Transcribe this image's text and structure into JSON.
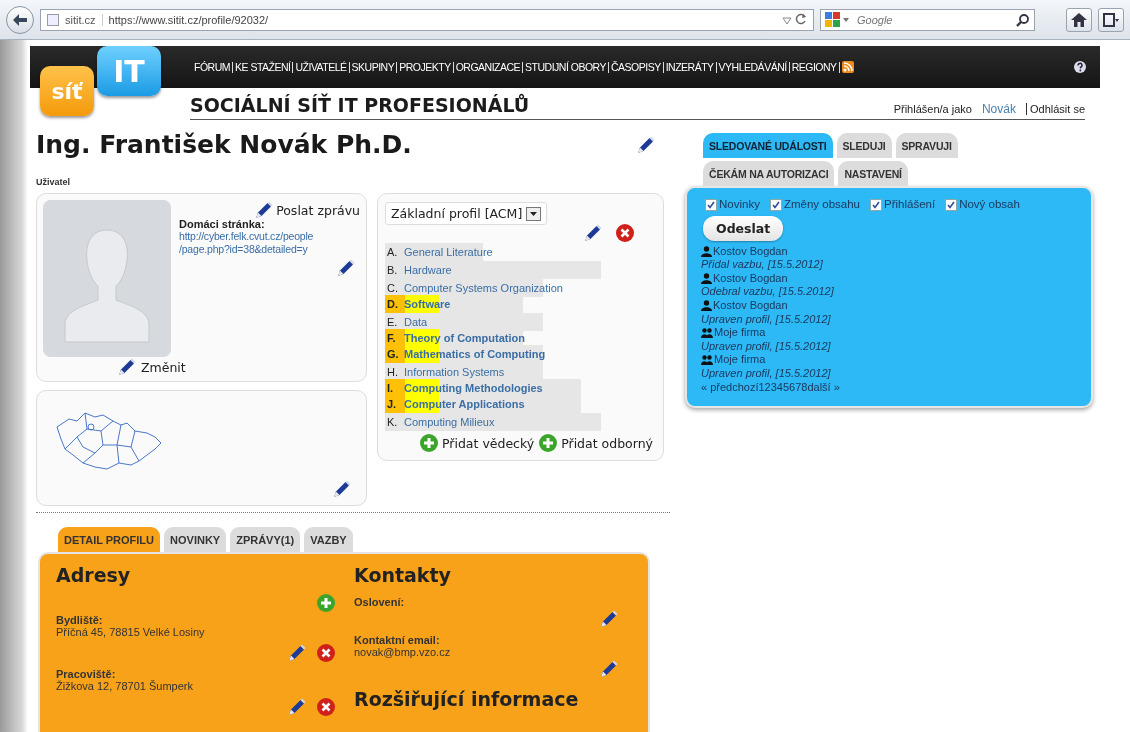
{
  "browser": {
    "site_identity": "sitit.cz",
    "url": "https://www.sitit.cz/profile/92032/",
    "search_placeholder": "Google"
  },
  "header": {
    "logo_left": "síť",
    "logo_right": "IT",
    "nav": [
      "FÓRUM",
      "KE STAŽENÍ",
      "UŽIVATELÉ",
      "SKUPINY",
      "PROJEKTY",
      "ORGANIZACE",
      "STUDIJNÍ OBORY",
      "ČASOPISY",
      "INZERÁTY",
      "VYHLEDÁVÁNÍ",
      "REGIONY"
    ],
    "site_title": "SOCIÁLNÍ SÍŤ IT PROFESIONÁLŮ",
    "login_label": "Přihlášen/a jako",
    "user_link": "Novák",
    "logout_link": "Odhlásit se"
  },
  "profile": {
    "name": "Ing. František Novák Ph.D.",
    "role": "Uživatel",
    "send_message": "Poslat zprávu",
    "homepage_label": "Domáci stránka:",
    "homepage_url_lines": [
      "http://cyber.felk.cvut.cz/people",
      "/page.php?id=38&detailed=y"
    ],
    "change_photo": "Změnit"
  },
  "acm": {
    "profile_select": "Základní profil [ACM]",
    "categories": [
      {
        "letter": "A.",
        "name": "General Literature",
        "highlighted": false
      },
      {
        "letter": "B.",
        "name": "Hardware",
        "highlighted": false
      },
      {
        "letter": "C.",
        "name": "Computer Systems Organization",
        "highlighted": false
      },
      {
        "letter": "D.",
        "name": "Software",
        "highlighted": true
      },
      {
        "letter": "E.",
        "name": "Data",
        "highlighted": false
      },
      {
        "letter": "F.",
        "name": "Theory of Computation",
        "highlighted": true
      },
      {
        "letter": "G.",
        "name": "Mathematics of Computing",
        "highlighted": true
      },
      {
        "letter": "H.",
        "name": "Information Systems",
        "highlighted": false
      },
      {
        "letter": "I.",
        "name": "Computing Methodologies",
        "highlighted": true
      },
      {
        "letter": "J.",
        "name": "Computer Applications",
        "highlighted": true
      },
      {
        "letter": "K.",
        "name": "Computing Milieux",
        "highlighted": false
      }
    ],
    "add_scientific": "Přidat vědecký",
    "add_professional": "Přidat odborný"
  },
  "events": {
    "tabs": [
      {
        "label": "SLEDOVANÉ UDÁLOSTI",
        "selected": true
      },
      {
        "label": "SLEDUJI",
        "selected": false
      },
      {
        "label": "SPRAVUJI",
        "selected": false
      },
      {
        "label": "ČEKÁM NA AUTORIZACI",
        "selected": false
      },
      {
        "label": "NASTAVENÍ",
        "selected": false
      }
    ],
    "filters": [
      {
        "label": "Novinky",
        "checked": true
      },
      {
        "label": "Změny obsahu",
        "checked": true
      },
      {
        "label": "Přihlášení",
        "checked": true
      },
      {
        "label": "Nový obsah",
        "checked": true
      }
    ],
    "submit": "Odeslat",
    "items": [
      {
        "kind": "user",
        "actor": "Kostov Bogdan",
        "action": "Přidal vazbu, [15.5.2012]"
      },
      {
        "kind": "user",
        "actor": "Kostov Bogdan",
        "action": "Odebral vazbu, [15.5.2012]"
      },
      {
        "kind": "user",
        "actor": "Kostov Bogdan",
        "action": "Upraven profil, [15.5.2012]"
      },
      {
        "kind": "group",
        "actor": "Moje firma",
        "action": "Upraven profil, [15.5.2012]"
      },
      {
        "kind": "group",
        "actor": "Moje firma",
        "action": "Upraven profil, [15.5.2012]"
      }
    ],
    "pager": "« předchozí12345678další »"
  },
  "detail": {
    "tabs": [
      {
        "label": "DETAIL PROFILU",
        "selected": true
      },
      {
        "label": "NOVINKY",
        "selected": false
      },
      {
        "label": "ZPRÁVY(1)",
        "selected": false
      },
      {
        "label": "VAZBY",
        "selected": false
      }
    ],
    "addresses_title": "Adresy",
    "addresses": [
      {
        "label": "Bydliště:",
        "value": "Příčná 45, 78815 Velké Losiny"
      },
      {
        "label": "Pracoviště:",
        "value": "Žižkova 12, 78701 Šumperk"
      }
    ],
    "contacts_title": "Kontakty",
    "contacts": [
      {
        "label": "Oslovení:"
      },
      {
        "label": "Kontaktní email:",
        "value": "novak@bmp.vzo.cz"
      }
    ],
    "extended_title": "Rozšiřující informace"
  }
}
